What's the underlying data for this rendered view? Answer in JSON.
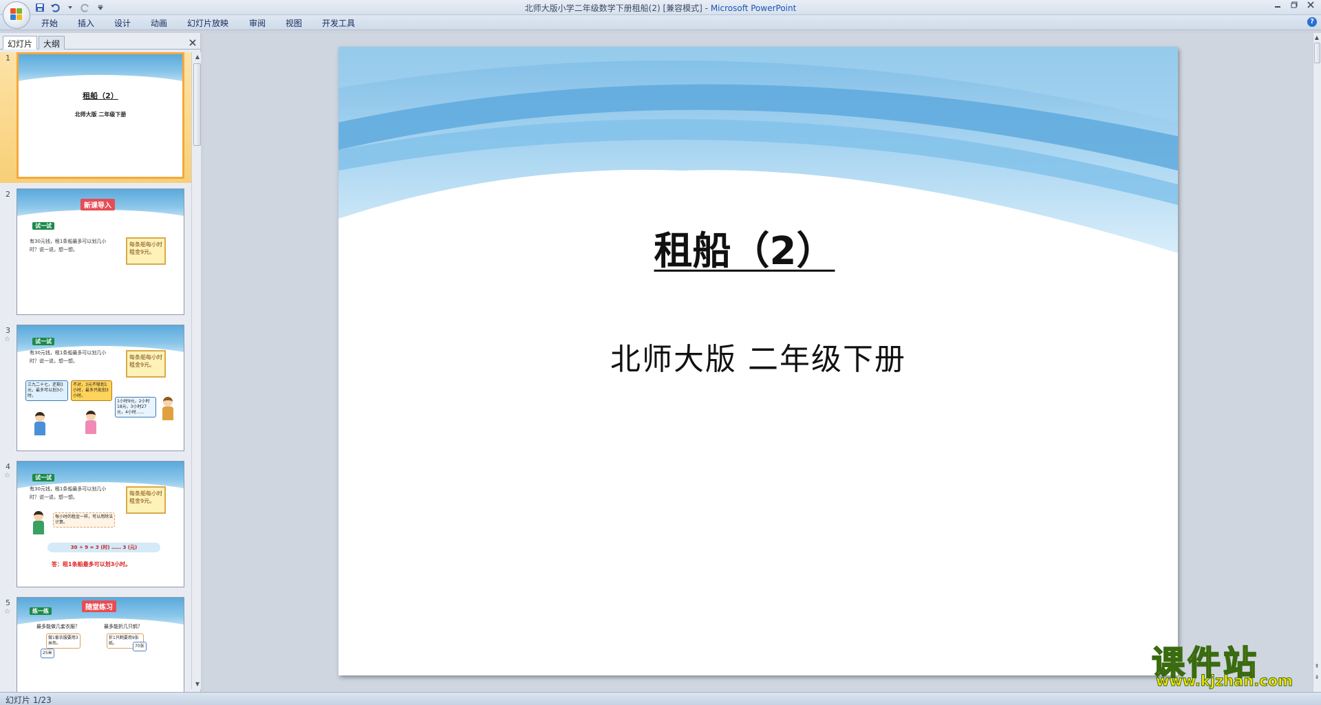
{
  "window": {
    "title": "北师大版小学二年级数学下册租船(2) [兼容模式]",
    "app_name": "Microsoft PowerPoint",
    "title_separator": " - "
  },
  "ribbon": {
    "tabs": [
      "开始",
      "插入",
      "设计",
      "动画",
      "幻灯片放映",
      "审阅",
      "视图",
      "开发工具"
    ],
    "help_glyph": "?"
  },
  "panel": {
    "tabs": [
      "幻灯片",
      "大纲"
    ],
    "active_tab": "幻灯片"
  },
  "thumbnails": [
    {
      "num": "1",
      "title": "租船（2）",
      "subtitle": "北师大版 二年级下册"
    },
    {
      "num": "2",
      "banner": "新课导入",
      "tag": "试一试",
      "text": "有30元钱，租1条船最多可以划几小时？说一说，想一想。",
      "note": "每条船每小时租金9元。"
    },
    {
      "num": "3",
      "tag": "试一试",
      "text": "有30元钱，租1条船最多可以划几小时？说一说，想一想。",
      "note": "每条船每小时租金9元。",
      "bubble1": "三九二十七，还剩3元，最多可以划3小时。",
      "bubble2": "不对，3元不够划1小时，最多只能划3小时。",
      "bubble3": "1小时9元，2小时18元，3小时27元，4小时……"
    },
    {
      "num": "4",
      "tag": "试一试",
      "text": "有30元钱，租1条船最多可以划几小时？说一说，想一想。",
      "note": "每条船每小时租金9元。",
      "bubble": "每小时的租金一样，可以用除法计算。",
      "equation": "30 ÷ 9 = 3 (时) …… 3 (元)",
      "answer": "答：租1条船最多可以划3小时。"
    },
    {
      "num": "5",
      "banner": "随堂练习",
      "tag": "练一练",
      "q1": "最多能做几套衣服？",
      "q2": "最多能折几只鹤？",
      "hint1": "做1套衣服要用3米布。",
      "hint2": "折1只鹤要用9张纸。",
      "price1": "25米",
      "price2": "70张"
    }
  ],
  "slide": {
    "title": "租船（2）",
    "subtitle": "北师大版 二年级下册"
  },
  "status": {
    "slide_indicator": "幻灯片 1/23"
  },
  "watermark": {
    "text": "课件站",
    "url": "www.kjzhan.com"
  },
  "colors": {
    "sky_dark": "#4fa3d8",
    "sky_light": "#bfe2f5",
    "selection": "#f4a83a",
    "banner_red": "#e84c53",
    "tag_green": "#1c8a4a",
    "watermark_yellow": "#ffe600"
  }
}
